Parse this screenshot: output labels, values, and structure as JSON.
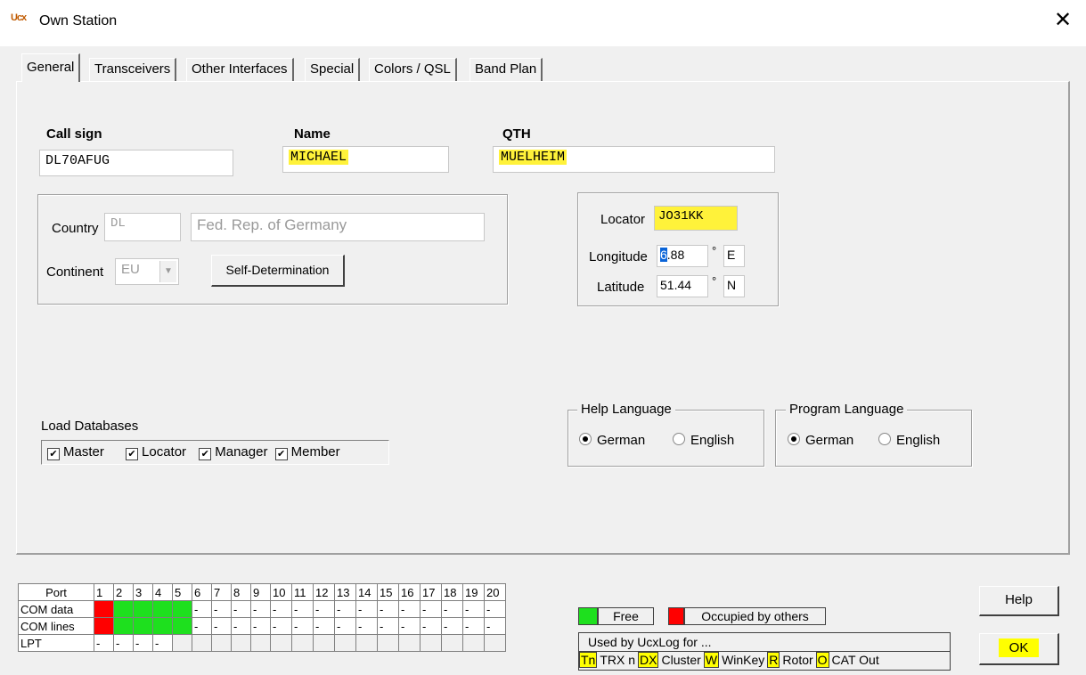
{
  "window": {
    "title": "Own Station",
    "icon_text": "Ucx",
    "close": "✕"
  },
  "tabs": [
    "General",
    "Transceivers",
    "Other Interfaces",
    "Special",
    "Colors / QSL",
    "Band Plan"
  ],
  "callsign": {
    "label": "Call sign",
    "value": "DL70AFUG"
  },
  "name": {
    "label": "Name",
    "value": "MICHAEL"
  },
  "qth": {
    "label": "QTH",
    "value": "MUELHEIM"
  },
  "country": {
    "label": "Country",
    "code": "DL",
    "name": "Fed. Rep. of Germany"
  },
  "continent": {
    "label": "Continent",
    "value": "EU"
  },
  "self_determination": "Self-Determination",
  "locator": {
    "label": "Locator",
    "value": "JO31KK"
  },
  "longitude": {
    "label": "Longitude",
    "value_first": "6",
    "value_rest": ".88",
    "deg": "°",
    "dir": "E"
  },
  "latitude": {
    "label": "Latitude",
    "value": "51.44",
    "deg": "°",
    "dir": "N"
  },
  "load_databases": {
    "label": "Load Databases",
    "items": [
      "Master",
      "Locator",
      "Manager",
      "Member"
    ]
  },
  "help_language": {
    "label": "Help Language",
    "options": [
      "German",
      "English"
    ],
    "selected": "German"
  },
  "program_language": {
    "label": "Program Language",
    "options": [
      "German",
      "English"
    ],
    "selected": "German"
  },
  "ports": {
    "header": "Port",
    "numbers": [
      "1",
      "2",
      "3",
      "4",
      "5",
      "6",
      "7",
      "8",
      "9",
      "10",
      "11",
      "12",
      "13",
      "14",
      "15",
      "16",
      "17",
      "18",
      "19",
      "20"
    ],
    "rows": [
      {
        "label": "COM data",
        "states": [
          "r",
          "g",
          "g",
          "g",
          "g",
          "-",
          "-",
          "-",
          "-",
          "-",
          "-",
          "-",
          "-",
          "-",
          "-",
          "-",
          "-",
          "-",
          "-",
          "-"
        ]
      },
      {
        "label": "COM lines",
        "states": [
          "r",
          "g",
          "g",
          "g",
          "g",
          "-",
          "-",
          "-",
          "-",
          "-",
          "-",
          "-",
          "-",
          "-",
          "-",
          "-",
          "-",
          "-",
          "-",
          "-"
        ]
      },
      {
        "label": "LPT",
        "states": [
          "-",
          "-",
          "-",
          "-",
          "e",
          "e",
          "e",
          "e",
          "e",
          "e",
          "e",
          "e",
          "e",
          "e",
          "e",
          "e",
          "e",
          "e",
          "e",
          "e"
        ]
      }
    ]
  },
  "legend": {
    "free": "Free",
    "occupied": "Occupied by others",
    "used_by": "Used by UcxLog for ...",
    "codes": [
      {
        "tag": "Tn",
        "text": "TRX n"
      },
      {
        "tag": "DX",
        "text": "Cluster"
      },
      {
        "tag": "W",
        "text": "WinKey"
      },
      {
        "tag": "R",
        "text": "Rotor"
      },
      {
        "tag": "O",
        "text": "CAT Out"
      }
    ]
  },
  "buttons": {
    "help": "Help",
    "ok": "OK"
  },
  "colors": {
    "free": "#1ee01e",
    "occupied": "#ff0000",
    "highlight": "#fff23a"
  }
}
